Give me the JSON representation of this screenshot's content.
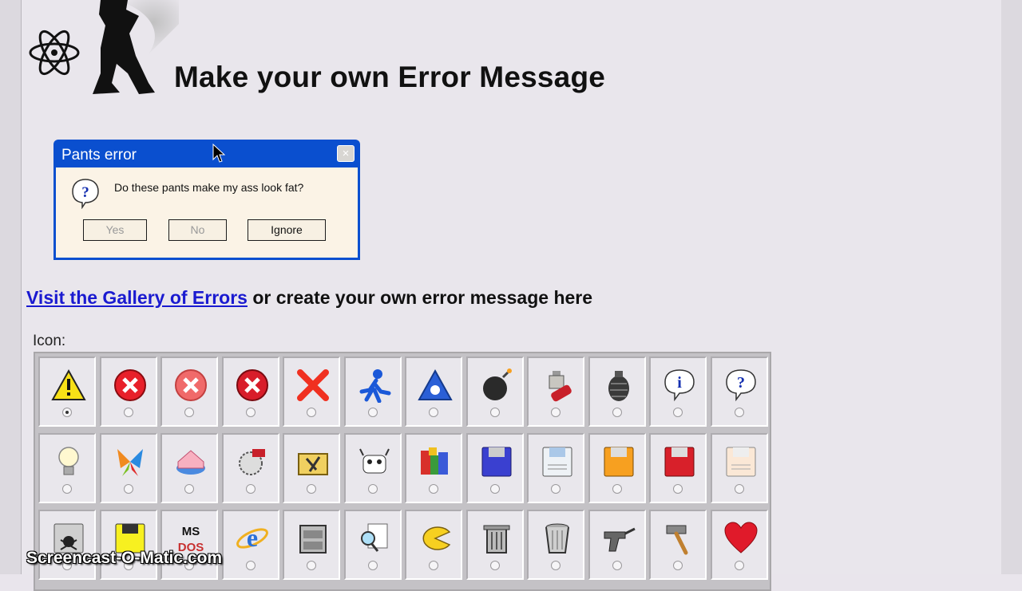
{
  "header": {
    "title": "Make your own Error Message"
  },
  "dialog": {
    "title": "Pants error",
    "message": "Do these pants make my ass look fat?",
    "buttons": [
      "Yes",
      "No",
      "Ignore"
    ],
    "close_symbol": "×"
  },
  "intro": {
    "link_text": "Visit the Gallery of Errors",
    "rest_text": " or create your own error message here"
  },
  "icon_section": {
    "label": "Icon:",
    "selected_index": 0,
    "icons": [
      [
        "warning-icon",
        "error-red-icon",
        "error-pink-icon",
        "error-red-dark-icon",
        "x-icon",
        "running-man-icon",
        "aol-triangle-icon",
        "bomb-icon",
        "dynamite-plunger-icon",
        "grenade-icon",
        "info-bubble-icon",
        "question-bubble-icon"
      ],
      [
        "lightbulb-icon",
        "msn-butterfly-icon",
        "cake-icon",
        "circular-saw-icon",
        "toolbox-icon",
        "cow-icon",
        "colorful-blocks-icon",
        "floppy-blue-icon",
        "floppy-white-icon",
        "floppy-orange-icon",
        "floppy-red-icon",
        "floppy-light-icon"
      ],
      [
        "floppy-skull-icon",
        "floppy-yellow-icon",
        "msdos-icon",
        "internet-explorer-icon",
        "cabinet-icon",
        "magnifier-file-icon",
        "pacman-icon",
        "trash-can-icon",
        "trash-can-metal-icon",
        "revolver-icon",
        "hammer-icon",
        "heart-icon"
      ]
    ]
  },
  "watermark": "Screencast-O-Matic.com"
}
